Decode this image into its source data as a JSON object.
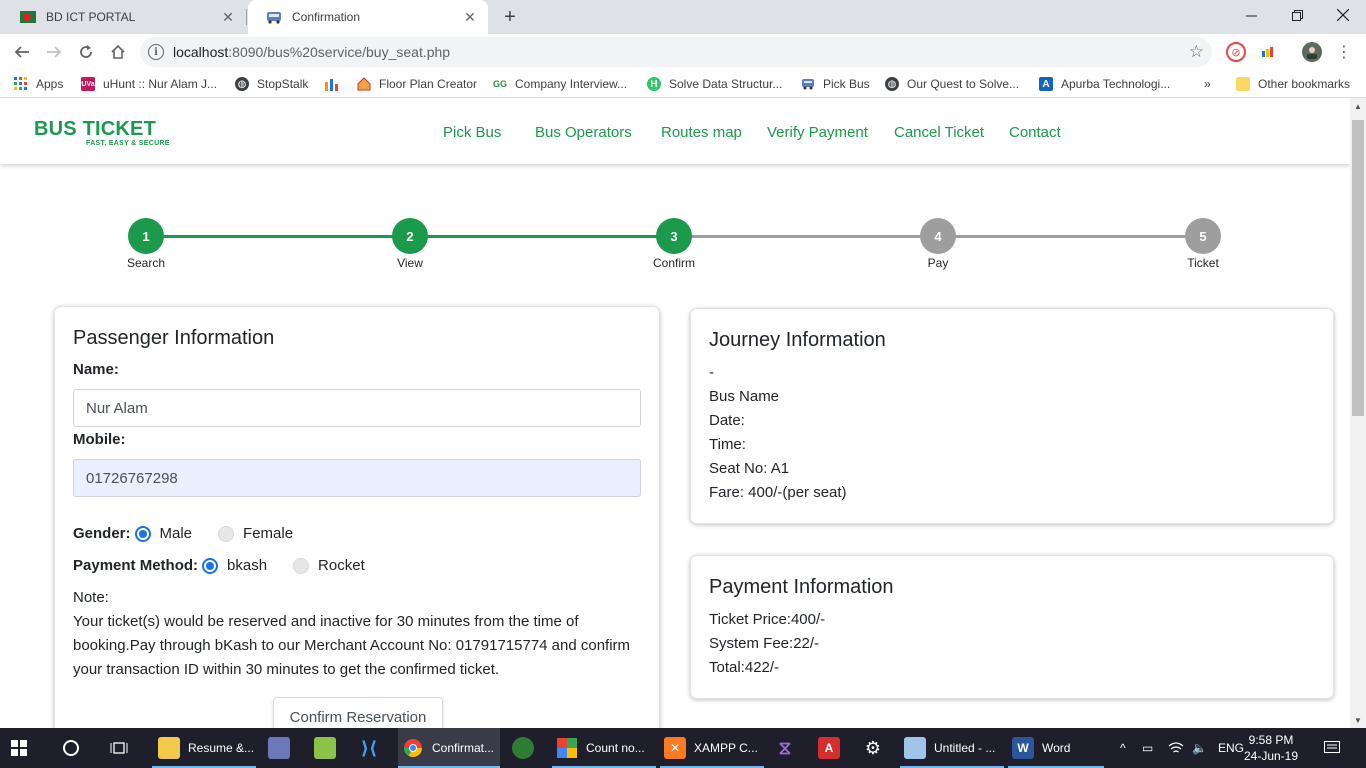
{
  "browser": {
    "tabs": [
      {
        "label": "BD ICT PORTAL"
      },
      {
        "label": "Confirmation"
      }
    ],
    "url_host": "localhost",
    "url_path": ":8090/bus%20service/buy_seat.php",
    "bookmarks": [
      {
        "label": "Apps"
      },
      {
        "label": "uHunt :: Nur Alam J..."
      },
      {
        "label": "StopStalk"
      },
      {
        "label": ""
      },
      {
        "label": "Floor Plan Creator"
      },
      {
        "label": "Company Interview..."
      },
      {
        "label": "Solve Data Structur..."
      },
      {
        "label": "Pick Bus"
      },
      {
        "label": "Our Quest to Solve..."
      },
      {
        "label": "Apurba Technologi..."
      }
    ],
    "bookmarks_more": "»",
    "other_bookmarks": "Other bookmarks"
  },
  "site": {
    "logo": "BUS TICKET",
    "tagline": "FAST, EASY & SECURE",
    "nav": [
      "Pick Bus",
      "Bus Operators",
      "Routes map",
      "Verify Payment",
      "Cancel Ticket",
      "Contact"
    ],
    "brand_color": "#1a9a4a"
  },
  "steps": [
    {
      "num": "2",
      "label": "View"
    },
    {
      "num": "3",
      "label": "Confirm"
    },
    {
      "num": "4",
      "label": "Pay"
    },
    {
      "num": "5",
      "label": "Ticket"
    },
    {
      "num": "1",
      "label": "Search"
    }
  ],
  "step_colors": {
    "done": "#1a9a4a",
    "todo": "#9e9e9e"
  },
  "completed_steps": 3,
  "passenger": {
    "title": "Passenger Information",
    "name_label": "Name:",
    "name_value": "Nur Alam",
    "mobile_label": "Mobile:",
    "mobile_value": "01726767298",
    "gender_label": "Gender:",
    "gender_options": [
      "Male",
      "Female"
    ],
    "gender_selected": "Male",
    "payment_label": "Payment Method:",
    "payment_options": [
      "bkash",
      "Rocket"
    ],
    "payment_selected": "bkash",
    "note_label": "Note:",
    "note_text": "Your ticket(s) would be reserved and inactive for 30 minutes from the time of booking.Pay through bKash to our Merchant Account No: 01791715774 and confirm your transaction ID within 30 minutes to get the confirmed ticket.",
    "confirm_button": "Confirm Reservation"
  },
  "journey": {
    "title": "Journey Information",
    "lines": [
      "-",
      "Bus Name",
      "Date:",
      "Time:",
      "Seat No: A1",
      "Fare: 400/-(per seat)"
    ]
  },
  "payment": {
    "title": "Payment Information",
    "lines": [
      "Ticket Price:400/-",
      "System Fee:22/-",
      "Total:422/-"
    ]
  },
  "taskbar": {
    "items": [
      {
        "label": "Resume &..."
      },
      {
        "label": "Confirmat..."
      },
      {
        "label": "Count no..."
      },
      {
        "label": "XAMPP C..."
      },
      {
        "label": "Untitled - ..."
      },
      {
        "label": "Word"
      }
    ],
    "language": "ENG",
    "time": "9:58 PM",
    "date": "24-Jun-19"
  }
}
